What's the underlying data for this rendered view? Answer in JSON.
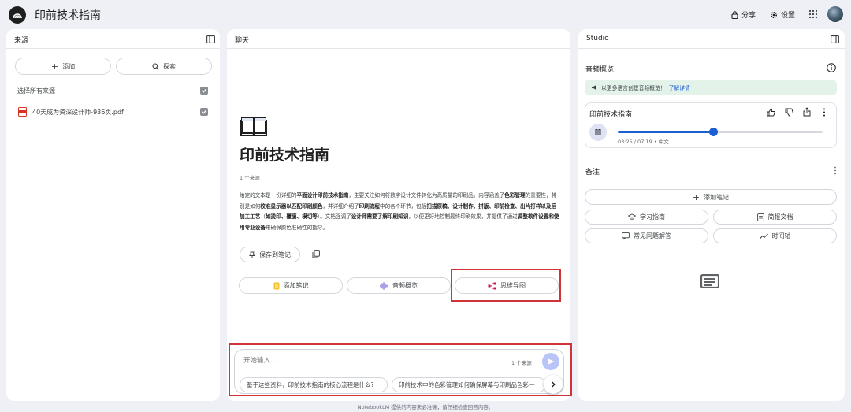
{
  "app": {
    "title": "印前技术指南"
  },
  "topbar": {
    "share_label": "分享",
    "settings_label": "设置"
  },
  "sources_panel": {
    "title": "来源",
    "add_label": "添加",
    "explore_label": "探索",
    "select_all_label": "选择所有来源",
    "items": [
      {
        "name": "40天成为资深设计师-936页.pdf",
        "checked": true
      }
    ]
  },
  "chat_panel": {
    "title": "聊天",
    "notebook_title": "印前技术指南",
    "source_count": "1 个来源",
    "summary": [
      {
        "t": "给定的文本是一份详细的"
      },
      {
        "t": "平面设计印前技术指南",
        "b": true
      },
      {
        "t": "，主要关注如何将数字设计文件转化为高质量的印刷品。内容涵盖了"
      },
      {
        "t": "色彩管理",
        "b": true
      },
      {
        "t": "的重要性，特别是如何"
      },
      {
        "t": "校准显示器以匹配印刷颜色",
        "b": true
      },
      {
        "t": "，并详细介绍了"
      },
      {
        "t": "印刷流程",
        "b": true
      },
      {
        "t": "中的各个环节，包括"
      },
      {
        "t": "扫描原稿、设计制作、拼版、印前检查、出片打样以及后加工工艺",
        "b": true
      },
      {
        "t": "（"
      },
      {
        "t": "如烫印、覆膜、模切等",
        "b": true
      },
      {
        "t": "）。文档强调了"
      },
      {
        "t": "设计师需要了解印刷知识",
        "b": true
      },
      {
        "t": "，以便更好地控制最终印刷效果，并提供了通过"
      },
      {
        "t": "调整软件设置和使用专业设备",
        "b": true
      },
      {
        "t": "来确保颜色准确性的指导。"
      }
    ],
    "save_note_label": "保存到笔记",
    "action_add_note": "添加笔记",
    "action_audio": "音频概览",
    "action_mindmap": "思维导图",
    "input_placeholder": "开始输入...",
    "input_source_count": "1 个来源",
    "suggestions": [
      "基于这些资料，印前技术指南的核心流程是什么?",
      "印前技术中的色彩管理如何确保屏幕与印刷品色彩一"
    ]
  },
  "studio_panel": {
    "title": "Studio",
    "audio_overview_label": "音频概览",
    "banner_text": "以更多语言创建音频概览！",
    "banner_link": "了解详情",
    "audio_title": "印前技术指南",
    "audio_time": "03:25 / 07:19 • 中文",
    "progress_fraction": 0.466,
    "notes_label": "备注",
    "add_note_label": "添加笔记",
    "study_guide_label": "学习指南",
    "briefing_label": "简报文档",
    "faq_label": "常见问题解答",
    "timeline_label": "时间轴"
  },
  "footer": {
    "text": "NotebookLM 提供的内容未必准确，请仔细检查回答内容。"
  },
  "colors": {
    "accent": "#1a5ed0",
    "highlight_box": "#d13438",
    "banner_bg": "#e3f3ea"
  }
}
